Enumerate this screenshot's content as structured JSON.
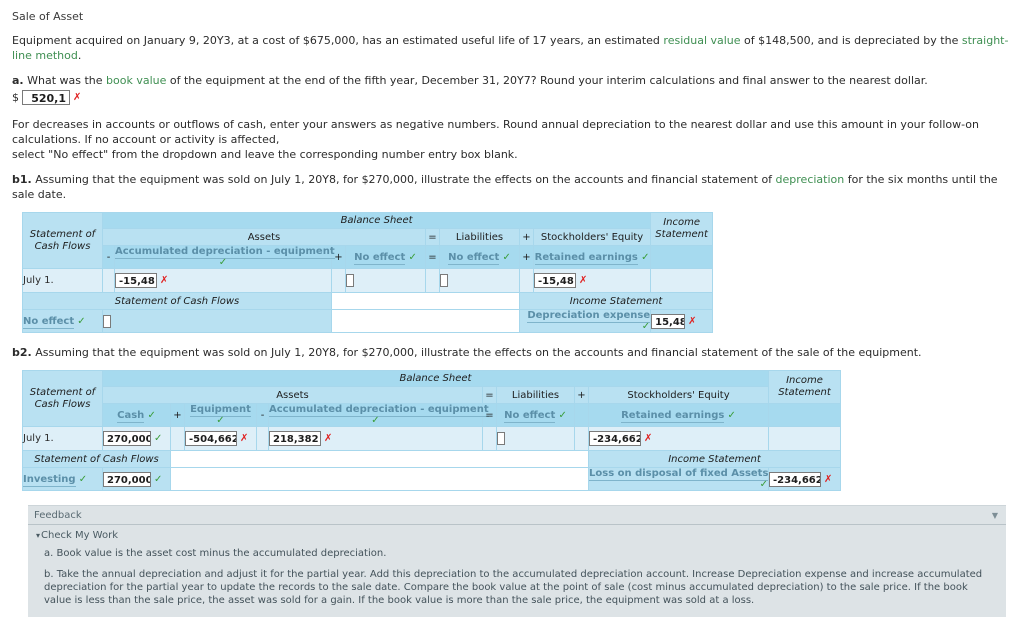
{
  "header": {
    "title": "Sale of Asset",
    "intro_1": "Equipment acquired on January 9, 20Y3, at a cost of $675,000, has an estimated useful life of 17 years, an estimated ",
    "intro_link_1": "residual value",
    "intro_2": " of $148,500, and is depreciated by the ",
    "intro_link_2": "straight-line method",
    "intro_3": "."
  },
  "part_a": {
    "label": "a.",
    "q_1": " What was the ",
    "q_link": "book value",
    "q_2": " of the equipment at the end of the fifth year, December 31, 20Y7? Round your interim calculations and final answer to the nearest dollar.",
    "currency": "$",
    "value": "520,1",
    "mark": "✗"
  },
  "instructions": {
    "line_1": "For decreases in accounts or outflows of cash, enter your answers as negative numbers. Round annual depreciation to the nearest dollar and use this amount in your follow-on calculations. If no account or activity is affected,",
    "line_2": "select \"No effect\" from the dropdown and leave the corresponding number entry box blank."
  },
  "part_b1": {
    "label": "b1.",
    "prompt_1": " Assuming that the equipment was sold on July 1, 20Y8, for $270,000, illustrate the effects on the accounts and financial statement of ",
    "prompt_link": "depreciation",
    "prompt_2": " for the six months until the sale date.",
    "table": {
      "corner": "Statement of\nCash Flows",
      "corner_line1": "Statement of",
      "corner_line2": "Cash Flows",
      "balance_sheet": "Balance Sheet",
      "income_statement_hdr_line1": "Income",
      "income_statement_hdr_line2": "Statement",
      "assets": "Assets",
      "liabilities": "Liabilities",
      "stockholders_equity": "Stockholders' Equity",
      "op_eq_1": "=",
      "op_plus_1": "+",
      "op_minus": "-",
      "op_plus_2": "+",
      "op_eq_2": "=",
      "op_plus_3": "+",
      "account_accum_dep": "Accumulated depreciation - equipment",
      "account_liab_noeffect": "No effect",
      "account_asset_noeffect": "No effect",
      "account_retained": "Retained earnings",
      "check_ok": "✓",
      "row_date": "July 1.",
      "accum_dep_value": "-15,48",
      "accum_dep_mark": "✗",
      "asset_noeffect_value": "",
      "liab_noeffect_value": "",
      "retained_value": "-15,48",
      "retained_mark": "✗",
      "scf_title": "Statement of Cash Flows",
      "is_title": "Income Statement",
      "scf_account": "No effect",
      "scf_value": "",
      "is_account": "Depreciation expense",
      "is_value": "15,48",
      "is_mark": "✗"
    }
  },
  "part_b2": {
    "label": "b2.",
    "prompt": " Assuming that the equipment was sold on July 1, 20Y8, for $270,000, illustrate the effects on the accounts and financial statement of the sale of the equipment.",
    "table": {
      "corner_line1": "Statement of",
      "corner_line2": "Cash Flows",
      "balance_sheet": "Balance Sheet",
      "income_statement_hdr_line1": "Income",
      "income_statement_hdr_line2": "Statement",
      "assets": "Assets",
      "liabilities": "Liabilities",
      "stockholders_equity": "Stockholders' Equity",
      "op_eq_1": "=",
      "op_plus_1": "+",
      "op_plus_cash": "+",
      "op_minus": "-",
      "op_eq_2": "=",
      "account_cash": "Cash",
      "account_equipment": "Equipment",
      "account_accum_dep": "Accumulated depreciation - equipment",
      "account_liab_noeffect": "No effect",
      "account_retained": "Retained earnings",
      "check_ok": "✓",
      "row_date": "July 1.",
      "cash_value": "270,000",
      "cash_mark": "✓",
      "equipment_value": "-504,662",
      "equipment_mark": "✗",
      "accum_dep_value": "218,382",
      "accum_dep_mark": "✗",
      "liab_value": "",
      "retained_value": "-234,662",
      "retained_mark": "✗",
      "scf_title": "Statement of Cash Flows",
      "is_title": "Income Statement",
      "scf_account": "Investing",
      "scf_value": "270,000",
      "scf_mark": "✓",
      "is_account": "Loss on disposal of fixed Assets",
      "is_value": "-234,662",
      "is_mark": "✗"
    }
  },
  "feedback": {
    "title": "Feedback",
    "collapse_glyph": "▼",
    "check_my_work": "Check My Work",
    "caret": "▾",
    "item_a": "a. Book value is the asset cost minus the accumulated depreciation.",
    "item_b": "b. Take the annual depreciation and adjust it for the partial year. Add this depreciation to the accumulated depreciation account. Increase Depreciation expense and increase accumulated depreciation for the partial year to update the records to the sale date. Compare the book value at the point of sale (cost minus accumulated depreciation) to the sale price. If the book value is less than the sale price, the asset was sold for a gain. If the book value is more than the sale price, the equipment was sold at a loss."
  },
  "colors": {
    "accent_link": "#5b8fa8",
    "green": "#3f8f52",
    "error": "#e02020",
    "ok": "#3a9d3a",
    "table_bg": "#b9e1f2",
    "table_hdr": "#a6daef",
    "row_bg": "#deeff8"
  }
}
